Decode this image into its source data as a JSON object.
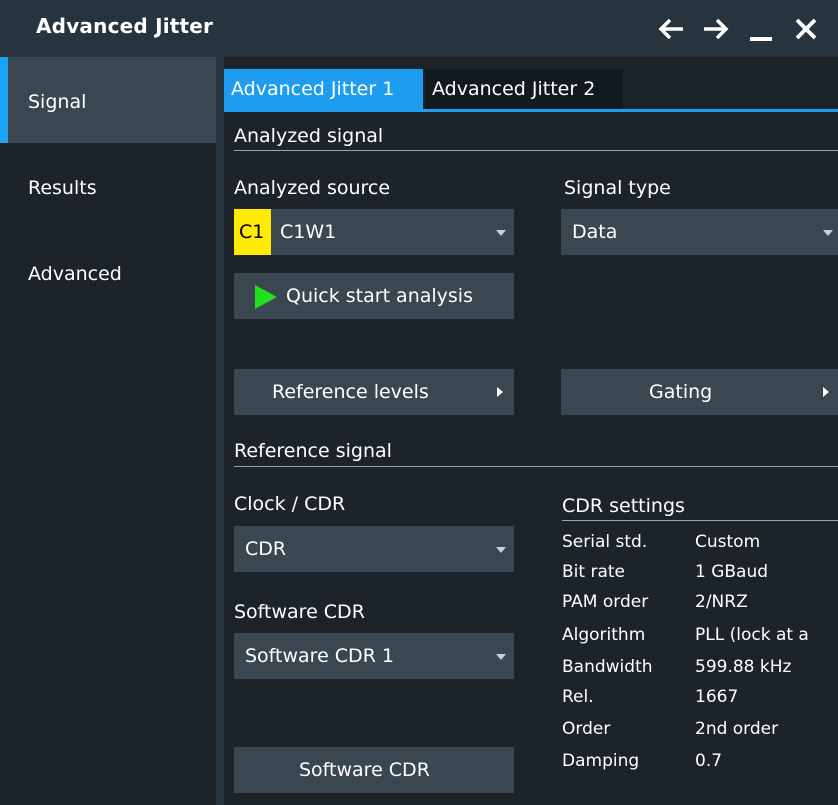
{
  "window": {
    "title": "Advanced Jitter",
    "icons": [
      "arrow-left-icon",
      "arrow-right-icon",
      "minimize-icon",
      "close-icon"
    ]
  },
  "sidebar": {
    "items": [
      {
        "label": "Signal",
        "active": true
      },
      {
        "label": "Results",
        "active": false
      },
      {
        "label": "Advanced",
        "active": false
      }
    ]
  },
  "tabs": [
    {
      "label": "Advanced Jitter 1",
      "active": true
    },
    {
      "label": "Advanced Jitter 2",
      "active": false
    }
  ],
  "analyzed_signal": {
    "heading": "Analyzed signal",
    "source_label": "Analyzed source",
    "source_badge": "C1",
    "source_value": "C1W1",
    "signal_type_label": "Signal type",
    "signal_type_value": "Data",
    "quick_start_label": "Quick start analysis",
    "reference_levels_label": "Reference levels",
    "gating_label": "Gating"
  },
  "reference_signal": {
    "heading": "Reference signal",
    "clock_label": "Clock / CDR",
    "clock_value": "CDR",
    "software_cdr_label": "Software CDR",
    "software_cdr_value": "Software CDR 1",
    "software_cdr_button": "Software CDR"
  },
  "cdr_settings": {
    "heading": "CDR settings",
    "rows": [
      {
        "key": "Serial std.",
        "value": "Custom"
      },
      {
        "key": "Bit rate",
        "value": "1 GBaud"
      },
      {
        "key": "PAM order",
        "value": "2/NRZ"
      },
      {
        "key": "Algorithm",
        "value": "PLL (lock at a"
      },
      {
        "key": "Bandwidth",
        "value": "599.88 kHz"
      },
      {
        "key": "Rel.",
        "value": "1667"
      },
      {
        "key": "Order",
        "value": "2nd order"
      },
      {
        "key": "Damping",
        "value": "0.7"
      }
    ]
  },
  "colors": {
    "accent": "#1e9cf0",
    "channel_badge": "#ffea00",
    "play_icon": "#22e01c",
    "panel_bg": "#1c2329",
    "control_bg": "#3a4650"
  }
}
